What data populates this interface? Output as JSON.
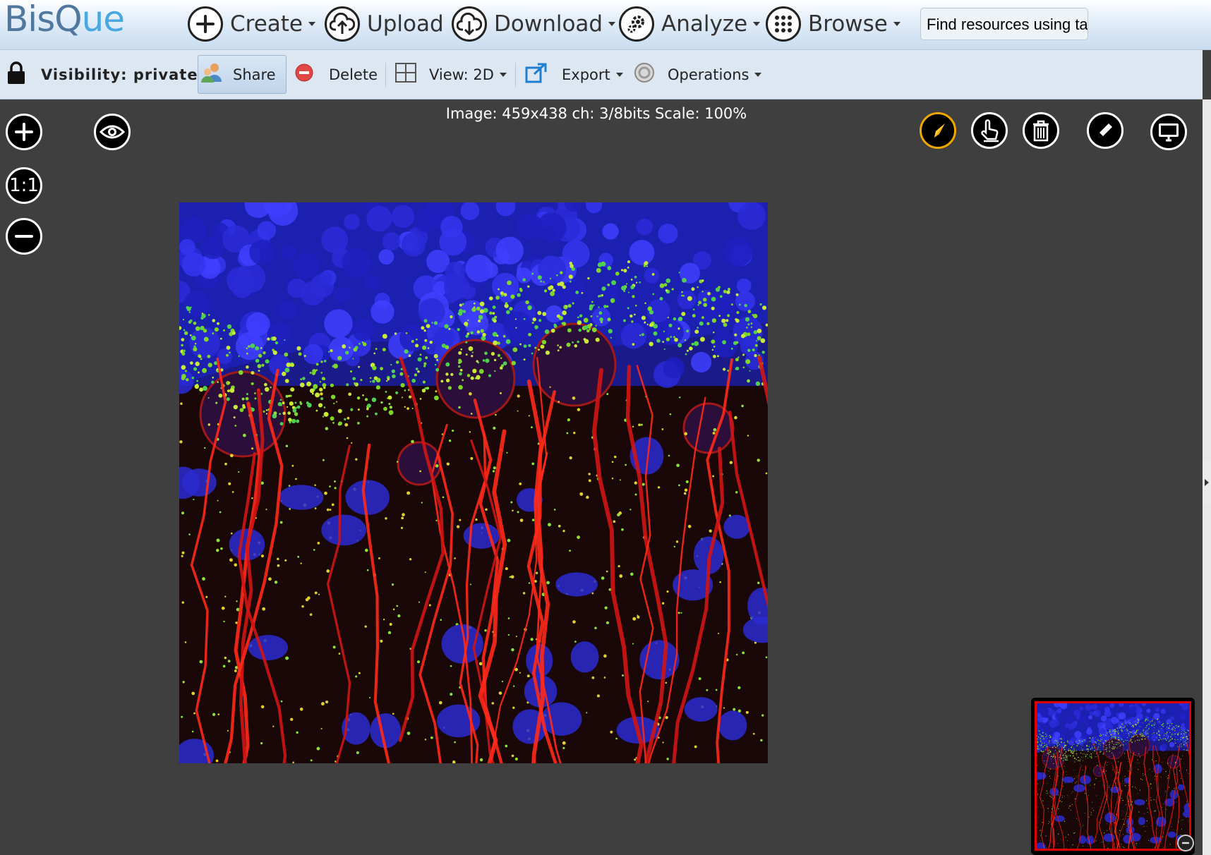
{
  "app": {
    "logo_part1": "BisQ",
    "logo_part2": "ue"
  },
  "nav": {
    "create": "Create",
    "upload": "Upload",
    "download": "Download",
    "analyze": "Analyze",
    "browse": "Browse",
    "search_value": "Find resources using ta"
  },
  "toolbar": {
    "visibility": "Visibility: private",
    "share": "Share",
    "delete": "Delete",
    "view": "View: 2D",
    "export": "Export",
    "operations": "Operations"
  },
  "viewer": {
    "info": "Image: 459x438 ch: 3/8bits Scale: 100%",
    "zoom_reset": "1:1"
  },
  "colors": {
    "active_tool": "#f0a800",
    "minimap_frame": "#e00000",
    "logo": "#50779e"
  },
  "icons": [
    "plus-circle-icon",
    "cloud-upload-icon",
    "cloud-download-icon",
    "gear-icon",
    "grid-icon",
    "lock-icon",
    "users-icon",
    "delete-icon",
    "layout-icon",
    "export-icon",
    "operations-icon",
    "zoom-in-icon",
    "eye-icon",
    "zoom-out-icon",
    "navigate-icon",
    "pointer-icon",
    "trash-icon",
    "pencil-icon",
    "monitor-icon"
  ]
}
